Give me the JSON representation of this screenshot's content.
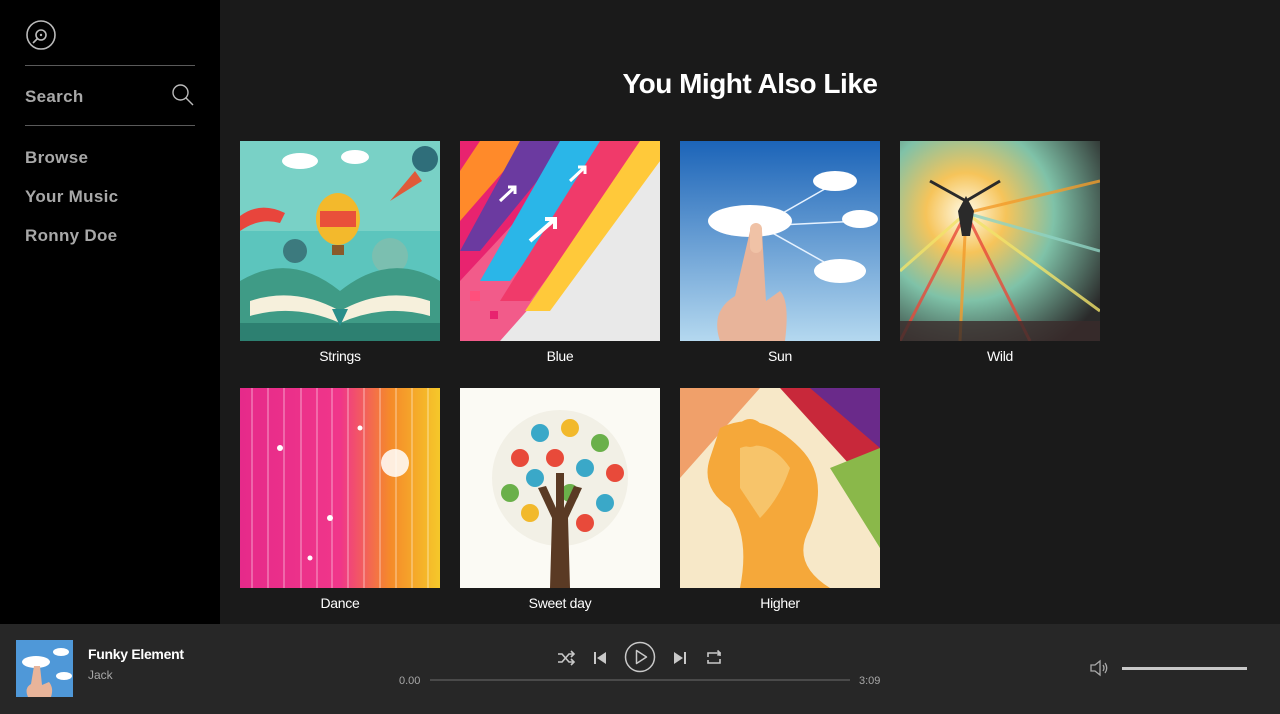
{
  "sidebar": {
    "logo_icon": "vinyl-disc-icon",
    "search_label": "Search",
    "search_icon": "search-icon",
    "nav": [
      {
        "label": "Browse"
      },
      {
        "label": "Your Music"
      },
      {
        "label": "Ronny Doe"
      }
    ]
  },
  "main": {
    "title": "You Might Also Like",
    "albums": [
      {
        "label": "Strings"
      },
      {
        "label": "Blue"
      },
      {
        "label": "Sun"
      },
      {
        "label": "Wild"
      },
      {
        "label": "Dance"
      },
      {
        "label": "Sweet day"
      },
      {
        "label": "Higher"
      }
    ]
  },
  "player": {
    "track_title": "Funky Element",
    "artist": "Jack",
    "time_current": "0.00",
    "time_total": "3:09",
    "progress": 0.0,
    "volume": 1.0,
    "controls": [
      "shuffle-icon",
      "previous-icon",
      "play-icon",
      "next-icon",
      "repeat-icon"
    ],
    "volume_icon": "volume-icon"
  },
  "colors": {
    "sidebar_bg": "#000000",
    "main_bg": "#1a1a1a",
    "player_bg": "#272727",
    "nav_text": "#a8a8a8",
    "title_text": "#ffffff"
  }
}
